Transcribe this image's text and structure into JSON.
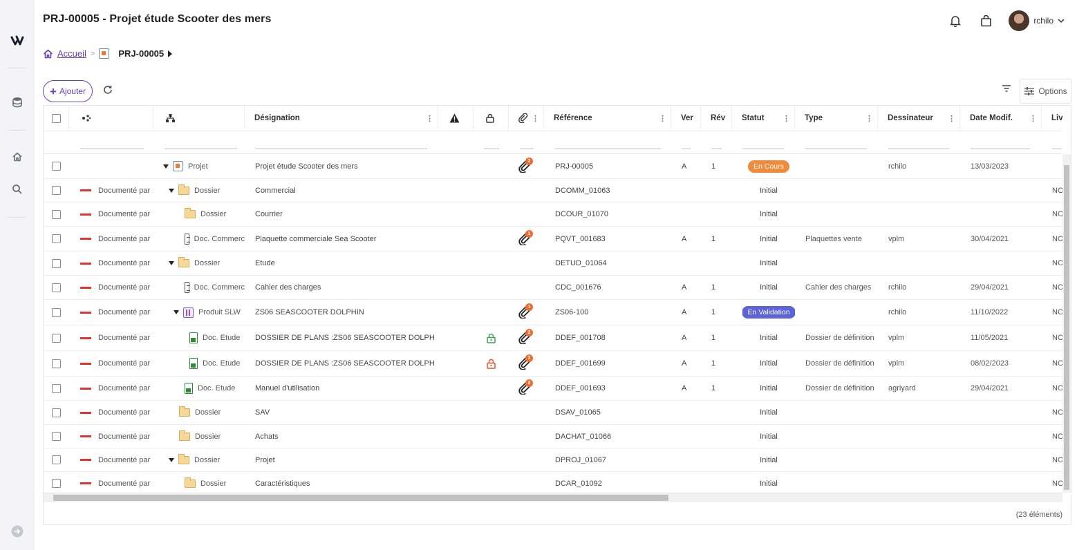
{
  "page": {
    "title": "PRJ-00005 - Projet étude Scooter des mers"
  },
  "header": {
    "username": "rchilo"
  },
  "breadcrumb": {
    "home": "Accueil",
    "current": "PRJ-00005"
  },
  "toolbar": {
    "add_label": "Ajouter",
    "options_label": "Options"
  },
  "grid": {
    "columns": [
      "Désignation",
      "Référence",
      "Ver",
      "Rév",
      "Statut",
      "Type",
      "Dessinateur",
      "Date Modif.",
      "Liv"
    ],
    "count_text": "(23 éléments)",
    "rows": [
      {
        "link": "",
        "type": "Projet",
        "designation": "Projet étude Scooter des mers",
        "clip": "2",
        "ref": "PRJ-00005",
        "ver": "A",
        "rev": "1",
        "status": "En Cours",
        "doctype": "",
        "author": "rchilo",
        "date": "13/03/2023",
        "liv": ""
      },
      {
        "link": "Documenté par",
        "type": "Dossier",
        "designation": "Commercial",
        "clip": "",
        "ref": "DCOMM_01063",
        "ver": "",
        "rev": "",
        "status": "Initial",
        "doctype": "",
        "author": "",
        "date": "",
        "liv": "NOI"
      },
      {
        "link": "Documenté par",
        "type": "Dossier",
        "designation": "Courrier",
        "clip": "",
        "ref": "DCOUR_01070",
        "ver": "",
        "rev": "",
        "status": "Initial",
        "doctype": "",
        "author": "",
        "date": "",
        "liv": "NOI"
      },
      {
        "link": "Documenté par",
        "type": "Doc. Commerc",
        "designation": "Plaquette commerciale Sea Scooter",
        "clip": "1",
        "ref": "PQVT_001683",
        "ver": "A",
        "rev": "1",
        "status": "Initial",
        "doctype": "Plaquettes vente",
        "author": "vplm",
        "date": "30/04/2021",
        "liv": "NOI"
      },
      {
        "link": "Documenté par",
        "type": "Dossier",
        "designation": "Etude",
        "clip": "",
        "ref": "DETUD_01064",
        "ver": "",
        "rev": "",
        "status": "Initial",
        "doctype": "",
        "author": "",
        "date": "",
        "liv": "NOI"
      },
      {
        "link": "Documenté par",
        "type": "Doc. Commerc",
        "designation": "Cahier des charges",
        "clip": "",
        "ref": "CDC_001676",
        "ver": "A",
        "rev": "1",
        "status": "Initial",
        "doctype": "Cahier des charges",
        "author": "rchilo",
        "date": "29/04/2021",
        "liv": "NOI"
      },
      {
        "link": "Documenté par",
        "type": "Produit SLW",
        "designation": "ZS06 SEASCOOTER DOLPHIN",
        "clip": "1",
        "ref": "ZS06-100",
        "ver": "A",
        "rev": "1",
        "status": "En Validation",
        "doctype": "",
        "author": "rchilo",
        "date": "11/10/2022",
        "liv": "NOI"
      },
      {
        "link": "Documenté par",
        "type": "Doc. Etude",
        "designation": "DOSSIER DE PLANS :ZS06 SEASCOOTER DOLPHIN",
        "clip": "2",
        "ref": "DDEF_001708",
        "ver": "A",
        "rev": "1",
        "status": "Initial",
        "doctype": "Dossier de définition",
        "author": "vplm",
        "date": "11/05/2021",
        "liv": "NOI"
      },
      {
        "link": "Documenté par",
        "type": "Doc. Etude",
        "designation": "DOSSIER DE PLANS :ZS06 SEASCOOTER DOLPHIN",
        "clip": "3",
        "ref": "DDEF_001699",
        "ver": "A",
        "rev": "1",
        "status": "Initial",
        "doctype": "Dossier de définition",
        "author": "vplm",
        "date": "08/02/2023",
        "liv": "NOI"
      },
      {
        "link": "Documenté par",
        "type": "Doc. Etude",
        "designation": "Manuel d'utilisation",
        "clip": "2",
        "ref": "DDEF_001693",
        "ver": "A",
        "rev": "1",
        "status": "Initial",
        "doctype": "Dossier de définition",
        "author": "agriyard",
        "date": "29/04/2021",
        "liv": "NOI"
      },
      {
        "link": "Documenté par",
        "type": "Dossier",
        "designation": "SAV",
        "clip": "",
        "ref": "DSAV_01065",
        "ver": "",
        "rev": "",
        "status": "Initial",
        "doctype": "",
        "author": "",
        "date": "",
        "liv": "NOI"
      },
      {
        "link": "Documenté par",
        "type": "Dossier",
        "designation": "Achats",
        "clip": "",
        "ref": "DACHAT_01066",
        "ver": "",
        "rev": "",
        "status": "Initial",
        "doctype": "",
        "author": "",
        "date": "",
        "liv": "NOI"
      },
      {
        "link": "Documenté par",
        "type": "Dossier",
        "designation": "Projet",
        "clip": "",
        "ref": "DPROJ_01067",
        "ver": "",
        "rev": "",
        "status": "Initial",
        "doctype": "",
        "author": "",
        "date": "",
        "liv": "NOI"
      },
      {
        "link": "Documenté par",
        "type": "Dossier",
        "designation": "Caractéristiques",
        "clip": "",
        "ref": "DCAR_01092",
        "ver": "",
        "rev": "",
        "status": "Initial",
        "doctype": "",
        "author": "",
        "date": "",
        "liv": "NOI"
      }
    ]
  }
}
